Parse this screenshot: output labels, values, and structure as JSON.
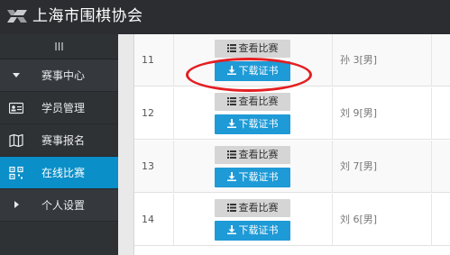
{
  "header": {
    "title": "上海市围棋协会"
  },
  "sidebar": {
    "toggle_label": "III",
    "items": [
      {
        "label": "赛事中心",
        "state": "expanded-group"
      },
      {
        "label": "学员管理"
      },
      {
        "label": "赛事报名"
      },
      {
        "label": "在线比赛",
        "state": "active"
      },
      {
        "label": "个人设置",
        "state": "collapsed-group"
      }
    ]
  },
  "table": {
    "rows": [
      {
        "num": "11",
        "view_label": "查看比赛",
        "download_label": "下载证书",
        "name": "孙  3[男]"
      },
      {
        "num": "12",
        "view_label": "查看比赛",
        "download_label": "下载证书",
        "name": "刘  9[男]"
      },
      {
        "num": "13",
        "view_label": "查看比赛",
        "download_label": "下载证书",
        "name": "刘  7[男]"
      },
      {
        "num": "14",
        "view_label": "查看比赛",
        "download_label": "下载证书",
        "name": "刘  6[男]"
      }
    ]
  },
  "colors": {
    "accent": "#1e9ad6",
    "active_nav": "#0a8fc8",
    "highlight": "#e41e22"
  }
}
